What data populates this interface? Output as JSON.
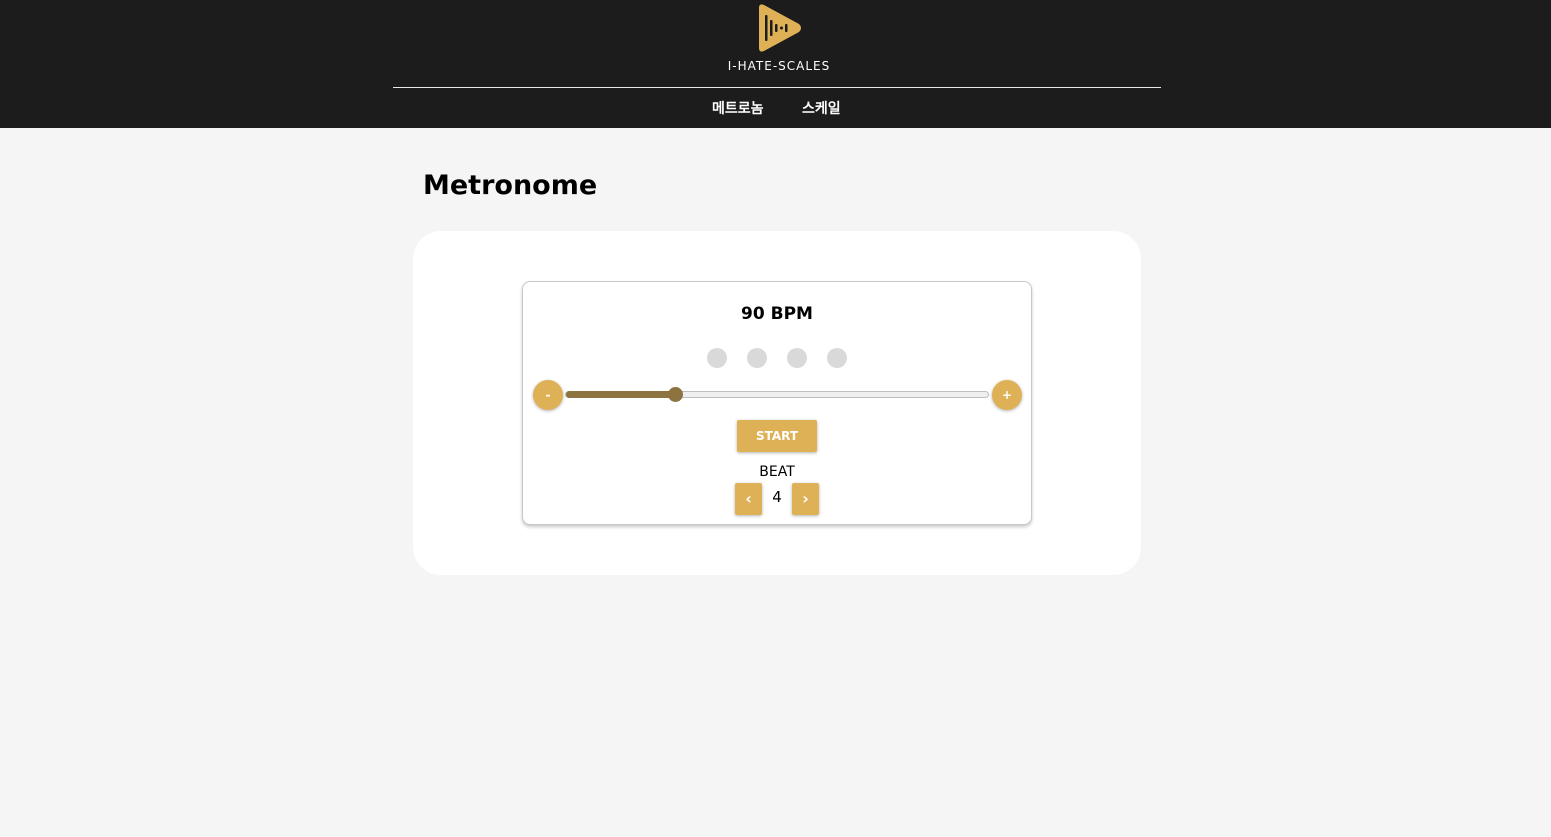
{
  "header": {
    "brand": "I-HATE-SCALES",
    "logo_icon": "play-soundwave-icon",
    "nav": [
      {
        "label": "메트로놈"
      },
      {
        "label": "스케일"
      }
    ]
  },
  "main": {
    "title": "Metronome",
    "metronome": {
      "bpm_text": "90 BPM",
      "bpm": 90,
      "bpm_slider_fraction": 0.26,
      "beat_indicators": [
        {
          "active": false
        },
        {
          "active": false
        },
        {
          "active": false
        },
        {
          "active": false
        }
      ],
      "decrement_label": "-",
      "increment_label": "+",
      "start_label": "START",
      "beat_label": "BEAT",
      "beat_value": "4",
      "beat_prev_icon": "chevron-left-icon",
      "beat_next_icon": "chevron-right-icon"
    }
  },
  "colors": {
    "header_bg": "#1c1c1c",
    "accent": "#dfb157",
    "slider_fill": "#8c7340",
    "page_bg": "#f5f5f5",
    "indicator": "#d9d9d9"
  }
}
